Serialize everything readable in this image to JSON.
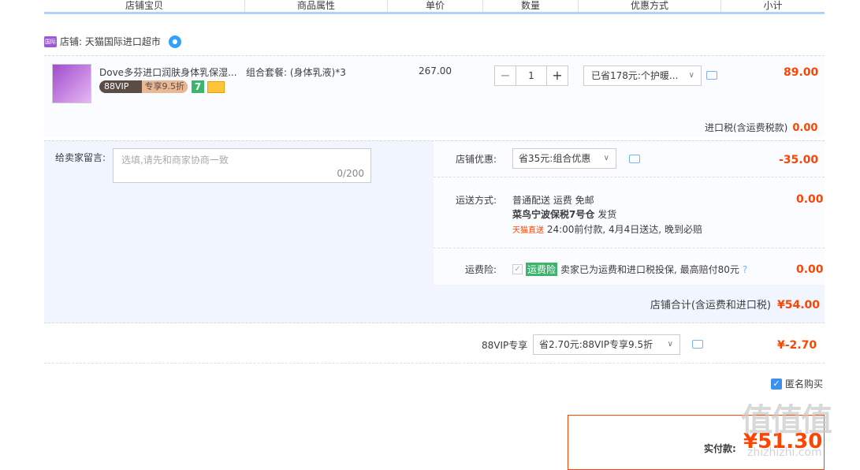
{
  "header": {
    "cols": [
      "店铺宝贝",
      "商品属性",
      "单价",
      "数量",
      "优惠方式",
      "小计"
    ]
  },
  "shop": {
    "label": "店铺: 天猫国际进口超市"
  },
  "item": {
    "title": "Dove多芬进口润肤身体乳保湿...",
    "vip_badge": "88VIP",
    "vip_discount": "专享9.5折",
    "seven_badge": "7",
    "attr": "组合套餐: (身体乳液)*3",
    "price": "267.00",
    "qty": "1",
    "qty_minus": "−",
    "qty_plus": "+",
    "promo": "已省178元:个护暖...",
    "subtotal": "89.00",
    "tax_label": "进口税(含运费税款)",
    "tax_value": "0.00"
  },
  "message": {
    "label": "给卖家留言:",
    "placeholder": "选填,请先和商家协商一致",
    "count": "0/200"
  },
  "shop_promo": {
    "label": "店铺优惠:",
    "value": "省35元:组合优惠",
    "amount": "-35.00"
  },
  "shipping": {
    "label": "运送方式:",
    "line1": "普通配送 运费 免邮",
    "warehouse": "菜鸟宁波保税7号仓",
    "dispatch": "发货",
    "express": "天猫直送",
    "eta": "24:00前付款, 4月4日送达, 晚到必赔",
    "amount": "0.00"
  },
  "insurance": {
    "label": "运费险:",
    "tag": "运费险",
    "text": "卖家已为运费和进口税投保, 最高赔付80元",
    "amount": "0.00"
  },
  "shop_total": {
    "label": "店铺合计(含运费和进口税)",
    "value": "¥54.00"
  },
  "vip88": {
    "label": "88VIP专享",
    "value": "省2.70元:88VIP专享9.5折",
    "amount": "¥-2.70"
  },
  "anon": {
    "label": "匿名购买"
  },
  "pay": {
    "label": "实付款:",
    "amount": "¥51.30"
  },
  "watermark": {
    "text": "值值值",
    "sub": "zhizhizhi.com"
  },
  "colors": {
    "accent": "#ff4400",
    "header_line": "#b2d1ff",
    "panel_bg": "#f0f5ff"
  }
}
